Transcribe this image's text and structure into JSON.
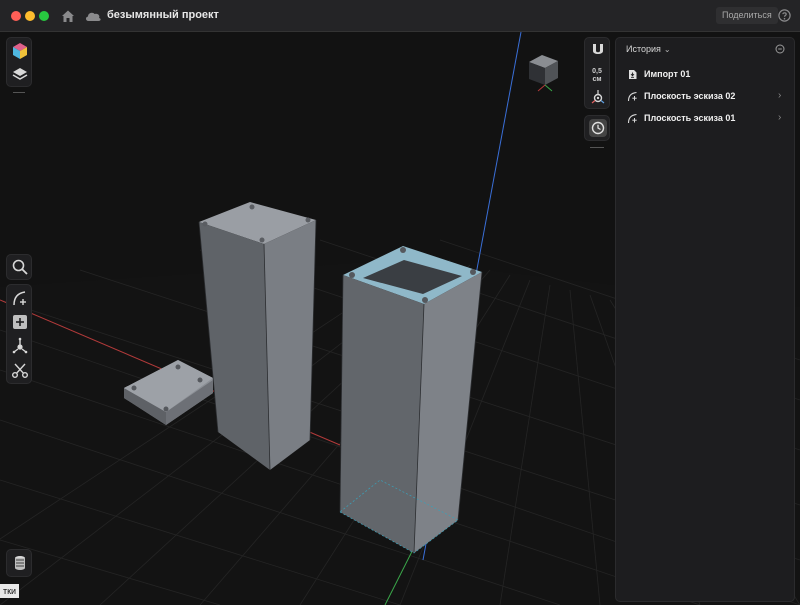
{
  "window": {
    "title": "безымянный проект",
    "share_label": "Поделиться"
  },
  "toolbar": {
    "scale_value": "0,5",
    "scale_unit": "см"
  },
  "history": {
    "title": "История",
    "items": [
      {
        "label": "Импорт 01",
        "icon": "import-file-icon",
        "has_arrow": false
      },
      {
        "label": "Плоскость эскиза 02",
        "icon": "sketch-plane-icon",
        "has_arrow": true
      },
      {
        "label": "Плоскость эскиза 01",
        "icon": "sketch-plane-icon",
        "has_arrow": true
      }
    ]
  },
  "tooltip": {
    "text": "тки"
  },
  "colors": {
    "accent_selected": "#8fb8c9",
    "model_gray": "#7d8187",
    "axis_red": "#b23a3a",
    "axis_green": "#3aa84a",
    "axis_blue": "#3a6fd8"
  }
}
